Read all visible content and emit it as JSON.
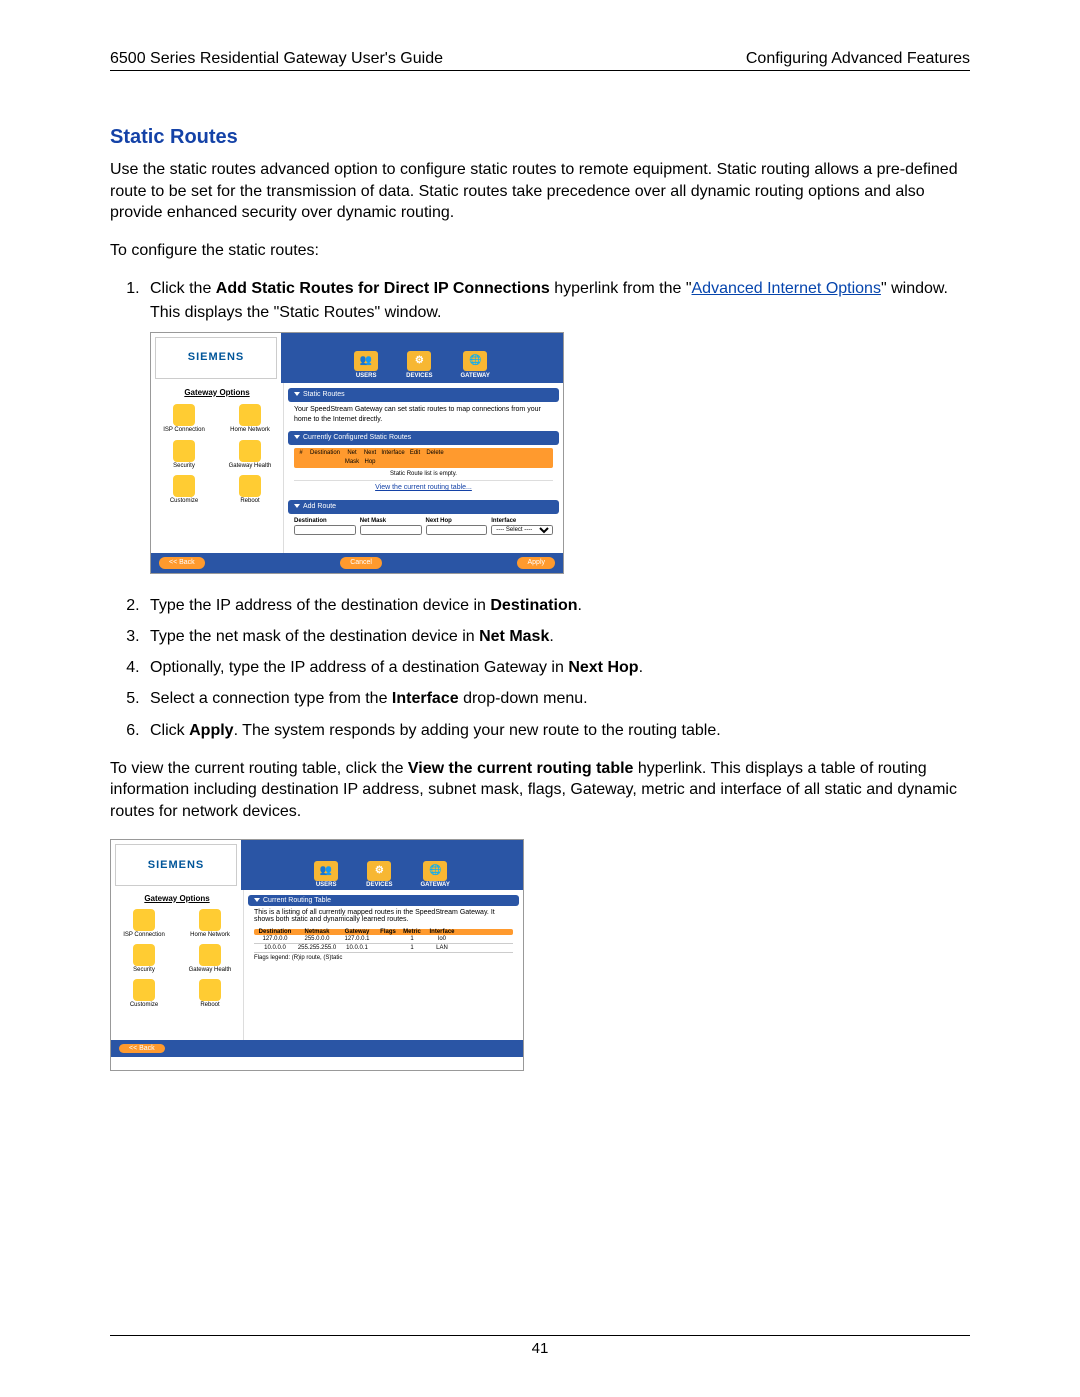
{
  "header": {
    "left": "6500 Series Residential Gateway User's Guide",
    "right": "Configuring Advanced Features"
  },
  "section_title": "Static Routes",
  "intro": "Use the static routes advanced option to configure static routes to remote equipment. Static routing allows a pre-defined route to be set for the transmission of data. Static routes take precedence over all dynamic routing options and also provide enhanced security over dynamic routing.",
  "to_configure": "To configure the static routes:",
  "step1": {
    "prefix": "Click the ",
    "bold1": "Add Static Routes for Direct IP Connections",
    "mid": " hyperlink from the \"",
    "link": "Advanced Internet Options",
    "suffix": "\" window. This displays the \"Static Routes\" window."
  },
  "step2": {
    "prefix": "Type the IP address of the destination device in ",
    "bold": "Destination",
    "suffix": "."
  },
  "step3": {
    "prefix": "Type the net mask of the destination device in ",
    "bold": "Net Mask",
    "suffix": "."
  },
  "step4": {
    "prefix": "Optionally, type the IP address of a destination Gateway in ",
    "bold": "Next Hop",
    "suffix": "."
  },
  "step5": {
    "prefix": "Select a connection type from the ",
    "bold": "Interface",
    "suffix": " drop-down menu."
  },
  "step6": {
    "prefix": "Click ",
    "bold": "Apply",
    "suffix": ". The system responds by adding your new route to the routing table."
  },
  "view_text": {
    "prefix": "To view the current routing table, click the ",
    "bold": "View the current routing table",
    "suffix": " hyperlink. This displays a table of routing information including destination IP address, subnet mask, flags, Gateway, metric and interface of all static and dynamic routes for network devices."
  },
  "page_number": "41",
  "ui": {
    "brand": "SIEMENS",
    "topbar": {
      "users": "USERS",
      "devices": "DEVICES",
      "gateway": "GATEWAY"
    },
    "sidebar": {
      "title": "Gateway Options",
      "items": [
        "ISP Connection",
        "Home Network",
        "Security",
        "Gateway Health",
        "Customize",
        "Reboot"
      ]
    },
    "panel1": {
      "title": "Static Routes",
      "desc": "Your SpeedStream Gateway can set static routes to map connections from your home to the Internet directly."
    },
    "panel2": {
      "title": "Currently Configured Static Routes",
      "cols": [
        "#",
        "Destination",
        "Net Mask",
        "Next Hop",
        "Interface",
        "Edit",
        "Delete"
      ],
      "empty": "Static Route list is empty.",
      "link": "View the current routing table..."
    },
    "panel3": {
      "title": "Add Route",
      "labels": [
        "Destination",
        "Net Mask",
        "Next Hop",
        "Interface"
      ],
      "select_default": "---- Select ----"
    },
    "buttons": {
      "back": "<< Back",
      "cancel": "Cancel",
      "apply": "Apply"
    },
    "routing": {
      "title": "Current Routing Table",
      "desc": "This is a listing of all currently mapped routes in the SpeedStream Gateway. It shows both static and dynamically learned routes.",
      "cols": [
        "Destination",
        "Netmask",
        "Gateway",
        "Flags",
        "Metric",
        "Interface"
      ],
      "rows": [
        {
          "dest": "127.0.0.0",
          "mask": "255.0.0.0",
          "gw": "127.0.0.1",
          "flags": "",
          "metric": "1",
          "iface": "lo0"
        },
        {
          "dest": "10.0.0.0",
          "mask": "255.255.255.0",
          "gw": "10.0.0.1",
          "flags": "",
          "metric": "1",
          "iface": "LAN"
        }
      ],
      "legend": "Flags legend: (R)ip route, (S)tatic"
    }
  }
}
